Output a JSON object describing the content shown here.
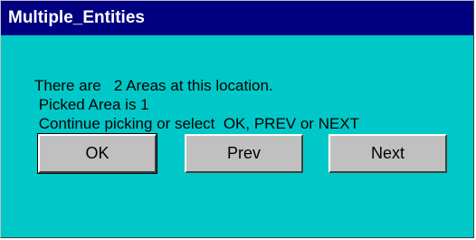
{
  "window": {
    "title": "Multiple_Entities"
  },
  "message": {
    "line1": "There are   2 Areas at this location.",
    "line2": " Picked Area is 1",
    "line3": " Continue picking or select  OK, PREV or NEXT"
  },
  "buttons": {
    "ok_label": "OK",
    "prev_label": "Prev",
    "next_label": "Next"
  },
  "colors": {
    "titlebar": "#000080",
    "dialog_background": "#00c8c8",
    "button_face": "#c0c0c0"
  }
}
